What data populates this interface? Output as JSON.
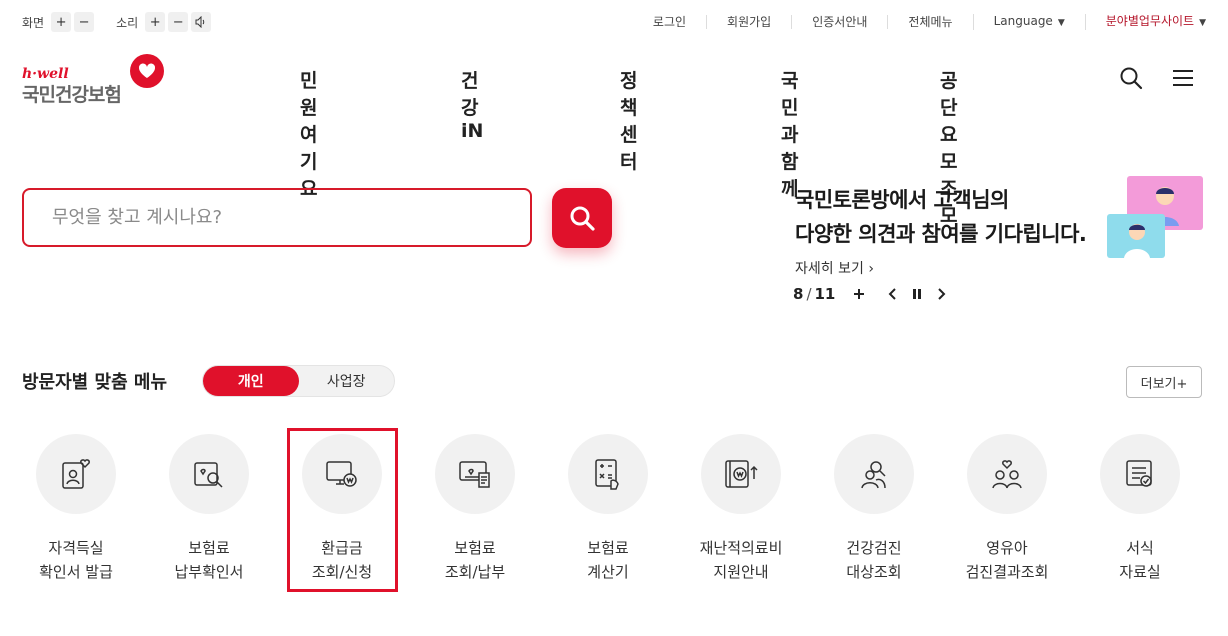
{
  "utility": {
    "screen_label": "화면",
    "sound_label": "소리",
    "plus": "+",
    "minus": "−",
    "links": [
      "로그인",
      "회원가입",
      "인증서안내",
      "전체메뉴"
    ],
    "language": "Language",
    "field_sites": "분야별업무사이트"
  },
  "logo": {
    "brand": "h·well",
    "name": "국민건강보험"
  },
  "gnb": [
    "민원여기요",
    "건강iN",
    "정책센터",
    "국민과함께",
    "공단요모조모"
  ],
  "search": {
    "placeholder": "무엇을 찾고 계시나요?"
  },
  "banner": {
    "line1": "국민토론방에서 고객님의",
    "line2": "다양한 의견과 참여를 기다립니다.",
    "more": "자세히 보기",
    "current": "8",
    "total": "11"
  },
  "section": {
    "title": "방문자별 맞춤 메뉴",
    "tabs": [
      "개인",
      "사업장"
    ],
    "more": "더보기+"
  },
  "menu": [
    {
      "label": "자격득실\n확인서 발급",
      "icon": "certificate-heart-icon"
    },
    {
      "label": "보험료\n납부확인서",
      "icon": "search-document-icon"
    },
    {
      "label": "환급금\n조회/신청",
      "icon": "refund-monitor-icon"
    },
    {
      "label": "보험료\n조회/납부",
      "icon": "payment-monitor-icon"
    },
    {
      "label": "보험료\n계산기",
      "icon": "calculator-icon"
    },
    {
      "label": "재난적의료비\n지원안내",
      "icon": "medical-cost-icon"
    },
    {
      "label": "건강검진\n대상조회",
      "icon": "checkup-people-icon"
    },
    {
      "label": "영유아\n검진결과조회",
      "icon": "family-heart-icon"
    },
    {
      "label": "서식\n자료실",
      "icon": "form-document-icon"
    }
  ],
  "colors": {
    "accent": "#e0112b",
    "field_sites": "#b5162b"
  }
}
